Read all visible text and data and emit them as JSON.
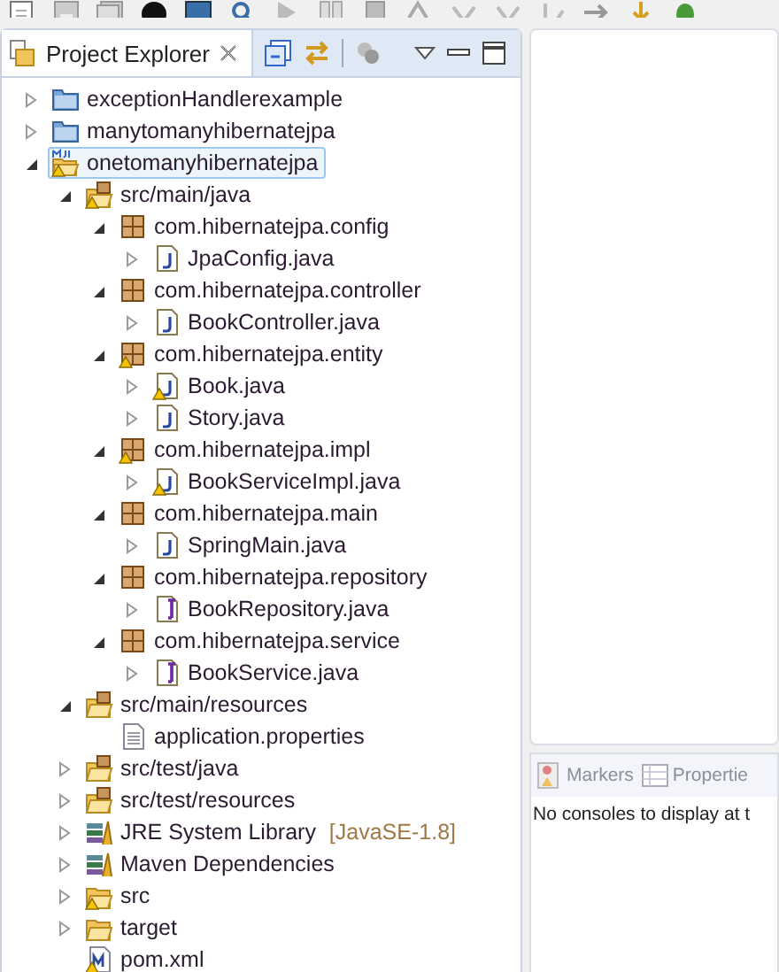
{
  "view": {
    "title": "Project Explorer"
  },
  "tree": [
    {
      "label": "exceptionHandlerexample",
      "kind": "project",
      "expanded": false,
      "warning": false,
      "selected": false
    },
    {
      "label": "manytomanyhibernatejpa",
      "kind": "project",
      "expanded": false,
      "warning": false,
      "selected": false
    },
    {
      "label": "onetomanyhibernatejpa",
      "kind": "maven-project",
      "expanded": true,
      "warning": true,
      "selected": true,
      "children": [
        {
          "label": "src/main/java",
          "kind": "source-folder",
          "expanded": true,
          "warning": true,
          "selected": false,
          "children": [
            {
              "label": "com.hibernatejpa.config",
              "kind": "package",
              "expanded": true,
              "warning": false,
              "selected": false,
              "children": [
                {
                  "label": "JpaConfig.java",
                  "kind": "class",
                  "expanded": false,
                  "warning": false,
                  "selected": false
                }
              ]
            },
            {
              "label": "com.hibernatejpa.controller",
              "kind": "package",
              "expanded": true,
              "warning": false,
              "selected": false,
              "children": [
                {
                  "label": "BookController.java",
                  "kind": "class",
                  "expanded": false,
                  "warning": false,
                  "selected": false
                }
              ]
            },
            {
              "label": "com.hibernatejpa.entity",
              "kind": "package",
              "expanded": true,
              "warning": true,
              "selected": false,
              "children": [
                {
                  "label": "Book.java",
                  "kind": "class",
                  "expanded": false,
                  "warning": true,
                  "selected": false
                },
                {
                  "label": "Story.java",
                  "kind": "class",
                  "expanded": false,
                  "warning": false,
                  "selected": false
                }
              ]
            },
            {
              "label": "com.hibernatejpa.impl",
              "kind": "package",
              "expanded": true,
              "warning": true,
              "selected": false,
              "children": [
                {
                  "label": "BookServiceImpl.java",
                  "kind": "class",
                  "expanded": false,
                  "warning": true,
                  "selected": false
                }
              ]
            },
            {
              "label": "com.hibernatejpa.main",
              "kind": "package",
              "expanded": true,
              "warning": false,
              "selected": false,
              "children": [
                {
                  "label": "SpringMain.java",
                  "kind": "class",
                  "expanded": false,
                  "warning": false,
                  "selected": false
                }
              ]
            },
            {
              "label": "com.hibernatejpa.repository",
              "kind": "package",
              "expanded": true,
              "warning": false,
              "selected": false,
              "children": [
                {
                  "label": "BookRepository.java",
                  "kind": "interface",
                  "expanded": false,
                  "warning": false,
                  "selected": false
                }
              ]
            },
            {
              "label": "com.hibernatejpa.service",
              "kind": "package",
              "expanded": true,
              "warning": false,
              "selected": false,
              "children": [
                {
                  "label": "BookService.java",
                  "kind": "interface",
                  "expanded": false,
                  "warning": false,
                  "selected": false
                }
              ]
            }
          ]
        },
        {
          "label": "src/main/resources",
          "kind": "source-folder",
          "expanded": true,
          "warning": false,
          "selected": false,
          "children": [
            {
              "label": "application.properties",
              "kind": "file",
              "warning": false,
              "selected": false
            }
          ]
        },
        {
          "label": "src/test/java",
          "kind": "source-folder",
          "expanded": false,
          "warning": false,
          "selected": false
        },
        {
          "label": "src/test/resources",
          "kind": "source-folder",
          "expanded": false,
          "warning": false,
          "selected": false
        },
        {
          "label": "JRE System Library",
          "decoration": "[JavaSE-1.8]",
          "kind": "library",
          "expanded": false,
          "warning": false,
          "selected": false
        },
        {
          "label": "Maven Dependencies",
          "kind": "library",
          "expanded": false,
          "warning": false,
          "selected": false
        },
        {
          "label": "src",
          "kind": "folder",
          "expanded": false,
          "warning": true,
          "selected": false
        },
        {
          "label": "target",
          "kind": "folder",
          "expanded": false,
          "warning": false,
          "selected": false
        },
        {
          "label": "pom.xml",
          "kind": "xml",
          "warning": true,
          "selected": false
        }
      ]
    }
  ],
  "bottom_panel": {
    "tabs": [
      {
        "label": "Markers",
        "selected": false
      },
      {
        "label": "Propertie",
        "selected": false
      }
    ],
    "message": "No consoles to display at t"
  }
}
